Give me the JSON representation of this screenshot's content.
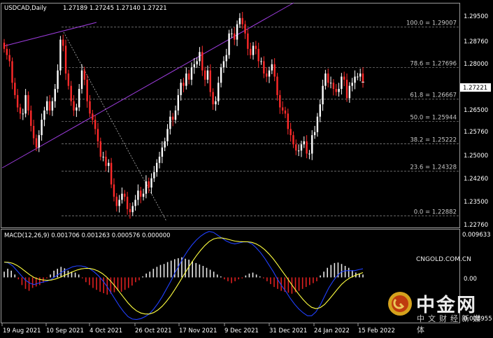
{
  "header": {
    "symbol_timeframe": "USDCAD,Daily",
    "ohlc": "1.27189 1.27245 1.27140 1.27221"
  },
  "price_axis": {
    "labels": [
      "1.29500",
      "1.28760",
      "1.28000",
      "1.27221",
      "1.26500",
      "1.25760",
      "1.25000",
      "1.24260",
      "1.23500",
      "1.22760"
    ],
    "current_price": "1.27221",
    "current_price_color": "#ffffff"
  },
  "fibonacci": {
    "levels": [
      {
        "label": "100.0 = 1.29007",
        "price": 1.29007
      },
      {
        "label": "78.6 = 1.27696",
        "price": 1.27696
      },
      {
        "label": "61.8 = 1.26667",
        "price": 1.26667
      },
      {
        "label": "50.0 = 1.25944",
        "price": 1.25944
      },
      {
        "label": "38.2 = 1.25222",
        "price": 1.25222
      },
      {
        "label": "23.6 = 1.24328",
        "price": 1.24328
      },
      {
        "label": "0.0 = 1.22882",
        "price": 1.22882
      }
    ]
  },
  "macd": {
    "title": "MACD(12,26,9) 0.001706 0.001263 0.000576 0.000000",
    "axis_labels": [
      "0.009633",
      "0.00",
      "-0.008955"
    ]
  },
  "time_axis": {
    "labels": [
      "19 Aug 2021",
      "10 Sep 2021",
      "4 Oct 2021",
      "26 Oct 2021",
      "17 Nov 2021",
      "9 Dec 2021",
      "31 Dec 2021",
      "24 Jan 2022",
      "15 Feb 2022"
    ]
  },
  "watermark": {
    "brand": "中金网",
    "url": "CNGOLD.COM.CN",
    "slogan": "中文财经新媒体"
  },
  "colors": {
    "bull": "#ffffff",
    "bear": "#ff2a2a",
    "trendline": "#9c3cdc",
    "macd_line": "#2040ff",
    "signal_line": "#ffff40",
    "grid": "#8a8a8a"
  },
  "chart_data": {
    "type": "candlestick",
    "price_range": [
      1.2255,
      1.2975
    ],
    "macd_range": [
      -0.009,
      0.0097
    ],
    "closes": [
      1.283,
      1.281,
      1.279,
      1.272,
      1.268,
      1.264,
      1.262,
      1.262,
      1.268,
      1.263,
      1.258,
      1.254,
      1.251,
      1.255,
      1.26,
      1.263,
      1.266,
      1.263,
      1.266,
      1.27,
      1.276,
      1.286,
      1.284,
      1.275,
      1.271,
      1.266,
      1.263,
      1.264,
      1.27,
      1.276,
      1.273,
      1.266,
      1.262,
      1.26,
      1.257,
      1.253,
      1.248,
      1.248,
      1.245,
      1.246,
      1.239,
      1.235,
      1.232,
      1.234,
      1.236,
      1.235,
      1.231,
      1.23,
      1.232,
      1.234,
      1.237,
      1.235,
      1.236,
      1.24,
      1.238,
      1.241,
      1.243,
      1.246,
      1.248,
      1.251,
      1.253,
      1.257,
      1.261,
      1.26,
      1.263,
      1.268,
      1.272,
      1.271,
      1.275,
      1.273,
      1.277,
      1.278,
      1.279,
      1.282,
      1.276,
      1.273,
      1.276,
      1.269,
      1.265,
      1.266,
      1.272,
      1.277,
      1.279,
      1.281,
      1.288,
      1.288,
      1.286,
      1.291,
      1.293,
      1.291,
      1.288,
      1.283,
      1.281,
      1.284,
      1.283,
      1.279,
      1.279,
      1.275,
      1.274,
      1.276,
      1.278,
      1.274,
      1.268,
      1.264,
      1.263,
      1.262,
      1.257,
      1.255,
      1.252,
      1.25,
      1.25,
      1.252,
      1.253,
      1.249,
      1.249,
      1.255,
      1.256,
      1.261,
      1.265,
      1.271,
      1.275,
      1.272,
      1.272,
      1.27,
      1.269,
      1.27,
      1.274,
      1.273,
      1.267,
      1.271,
      1.272,
      1.274,
      1.274,
      1.275,
      1.27221
    ],
    "macd_hist": [
      0.0012,
      0.0018,
      0.0014,
      0.0006,
      -0.0004,
      -0.0016,
      -0.0024,
      -0.0028,
      -0.0022,
      -0.0019,
      -0.0016,
      -0.0011,
      -0.0002,
      0.0006,
      0.0014,
      0.0018,
      0.0022,
      0.0019,
      0.0014,
      0.0012,
      0.001,
      0.0006,
      -0.0002,
      -0.001,
      -0.0016,
      -0.0022,
      -0.0026,
      -0.003,
      -0.0033,
      -0.0036,
      -0.0034,
      -0.0031,
      -0.0028,
      -0.003,
      -0.0026,
      -0.0022,
      -0.0017,
      -0.001,
      -0.0006,
      0.0002,
      0.0008,
      0.0012,
      0.0018,
      0.0022,
      0.0026,
      0.0028,
      0.0032,
      0.0035,
      0.0038,
      0.004,
      0.0042,
      0.0039,
      0.0037,
      0.0034,
      0.003,
      0.0027,
      0.0024,
      0.002,
      0.0016,
      0.0012,
      0.0006,
      0.0002,
      -0.0004,
      -0.0008,
      -0.0012,
      -0.0008,
      -0.0004,
      -0.0002,
      0.0004,
      0.0008,
      0.001,
      0.0006,
      0.0002,
      -0.0002,
      -0.0008,
      -0.0014,
      -0.002,
      -0.0024,
      -0.0028,
      -0.003,
      -0.0032,
      -0.0034,
      -0.0031,
      -0.0028,
      -0.0024,
      -0.002,
      -0.0016,
      -0.0012,
      -0.0008,
      0.0004,
      0.0012,
      0.002,
      0.0026,
      0.003,
      0.0031,
      0.0028,
      0.0024,
      0.002,
      0.0015,
      0.001,
      0.0008,
      0.0006
    ],
    "macd_line": [
      0.0032,
      0.003,
      0.0024,
      0.0014,
      0.0004,
      -0.0006,
      -0.0012,
      -0.0015,
      -0.0012,
      -0.001,
      -0.0008,
      -0.0004,
      0.0002,
      0.0008,
      0.0014,
      0.0018,
      0.0022,
      0.0024,
      0.0024,
      0.0022,
      0.0018,
      0.0012,
      0.0004,
      -0.0006,
      -0.0018,
      -0.0032,
      -0.0046,
      -0.006,
      -0.0072,
      -0.0082,
      -0.0087,
      -0.0088,
      -0.0086,
      -0.0082,
      -0.0076,
      -0.0066,
      -0.0054,
      -0.004,
      -0.0024,
      -0.0008,
      0.001,
      0.0026,
      0.0042,
      0.0056,
      0.0068,
      0.0078,
      0.0086,
      0.0092,
      0.0096,
      0.0094,
      0.0088,
      0.0082,
      0.0076,
      0.0072,
      0.007,
      0.0072,
      0.0074,
      0.0074,
      0.007,
      0.0062,
      0.0052,
      0.004,
      0.0026,
      0.0012,
      -0.0004,
      -0.0018,
      -0.003,
      -0.0044,
      -0.0056,
      -0.0066,
      -0.0074,
      -0.008,
      -0.008,
      -0.0072,
      -0.0058,
      -0.004,
      -0.0022,
      -0.0008,
      0.0004,
      0.0012,
      0.0014,
      0.0014,
      0.0014,
      0.0016,
      0.0018
    ]
  }
}
